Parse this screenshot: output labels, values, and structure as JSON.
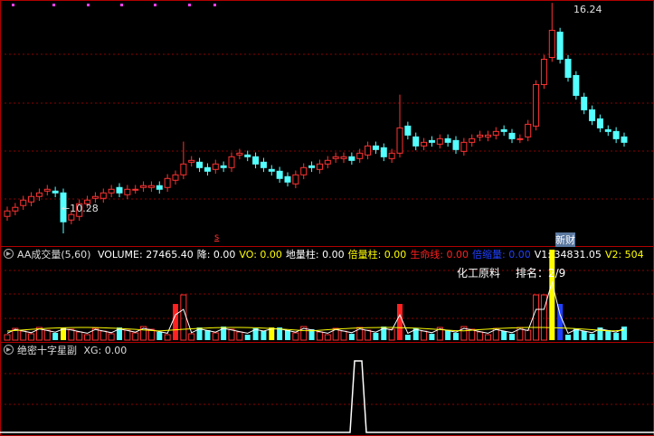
{
  "price_panel": {
    "high_label": "16.24",
    "low_label": "10.28",
    "marker_s": "s",
    "marker_news": "新财"
  },
  "volume_panel": {
    "title": "AA成交量(5,60)",
    "items": [
      {
        "key": "VOLUME:",
        "value": "27465.40",
        "color": "#ffffff"
      },
      {
        "key": "降:",
        "value": "0.00",
        "color": "#ffffff"
      },
      {
        "key": "VO:",
        "value": "0.00",
        "color": "#ffff00"
      },
      {
        "key": "地量柱:",
        "value": "0.00",
        "color": "#ffffff"
      },
      {
        "key": "倍量柱:",
        "value": "0.00",
        "color": "#ffff00"
      },
      {
        "key": "生命线:",
        "value": "0.00",
        "color": "#ff2020"
      },
      {
        "key": "倍缩量:",
        "value": "0.00",
        "color": "#2040ff"
      },
      {
        "key": "V1:",
        "value": "34831.05",
        "color": "#ffffff"
      },
      {
        "key": "V2:",
        "value": "504",
        "color": "#ffff00"
      }
    ],
    "industry": "化工原料",
    "rank": "排名：2/9"
  },
  "signal_panel": {
    "title": "绝密十字星副",
    "xg": "XG: 0.00"
  },
  "colors": {
    "up": "#ff3232",
    "down": "#54ffff",
    "grid": "#8b0000",
    "border": "#b00000"
  },
  "chart_data": {
    "type": "candlestick",
    "price_high": 16.24,
    "price_low": 10.28,
    "close_series": [
      10.6,
      10.7,
      10.9,
      11.0,
      11.1,
      11.2,
      11.1,
      10.3,
      10.5,
      10.8,
      10.9,
      11.0,
      11.1,
      11.2,
      11.1,
      11.2,
      11.2,
      11.3,
      11.3,
      11.2,
      11.5,
      11.6,
      11.9,
      12.0,
      11.8,
      11.7,
      11.9,
      11.8,
      12.1,
      12.2,
      12.1,
      11.9,
      11.8,
      11.7,
      11.5,
      11.4,
      11.6,
      11.8,
      11.8,
      11.9,
      12.0,
      12.1,
      12.1,
      12.0,
      12.2,
      12.4,
      12.3,
      12.1,
      12.2,
      12.9,
      12.7,
      12.4,
      12.5,
      12.5,
      12.6,
      12.5,
      12.3,
      12.5,
      12.6,
      12.7,
      12.7,
      12.8,
      12.8,
      12.6,
      12.6,
      13.0,
      14.1,
      14.8,
      15.6,
      14.8,
      14.3,
      13.8,
      13.4,
      13.1,
      12.9,
      12.8,
      12.6,
      12.5
    ]
  }
}
